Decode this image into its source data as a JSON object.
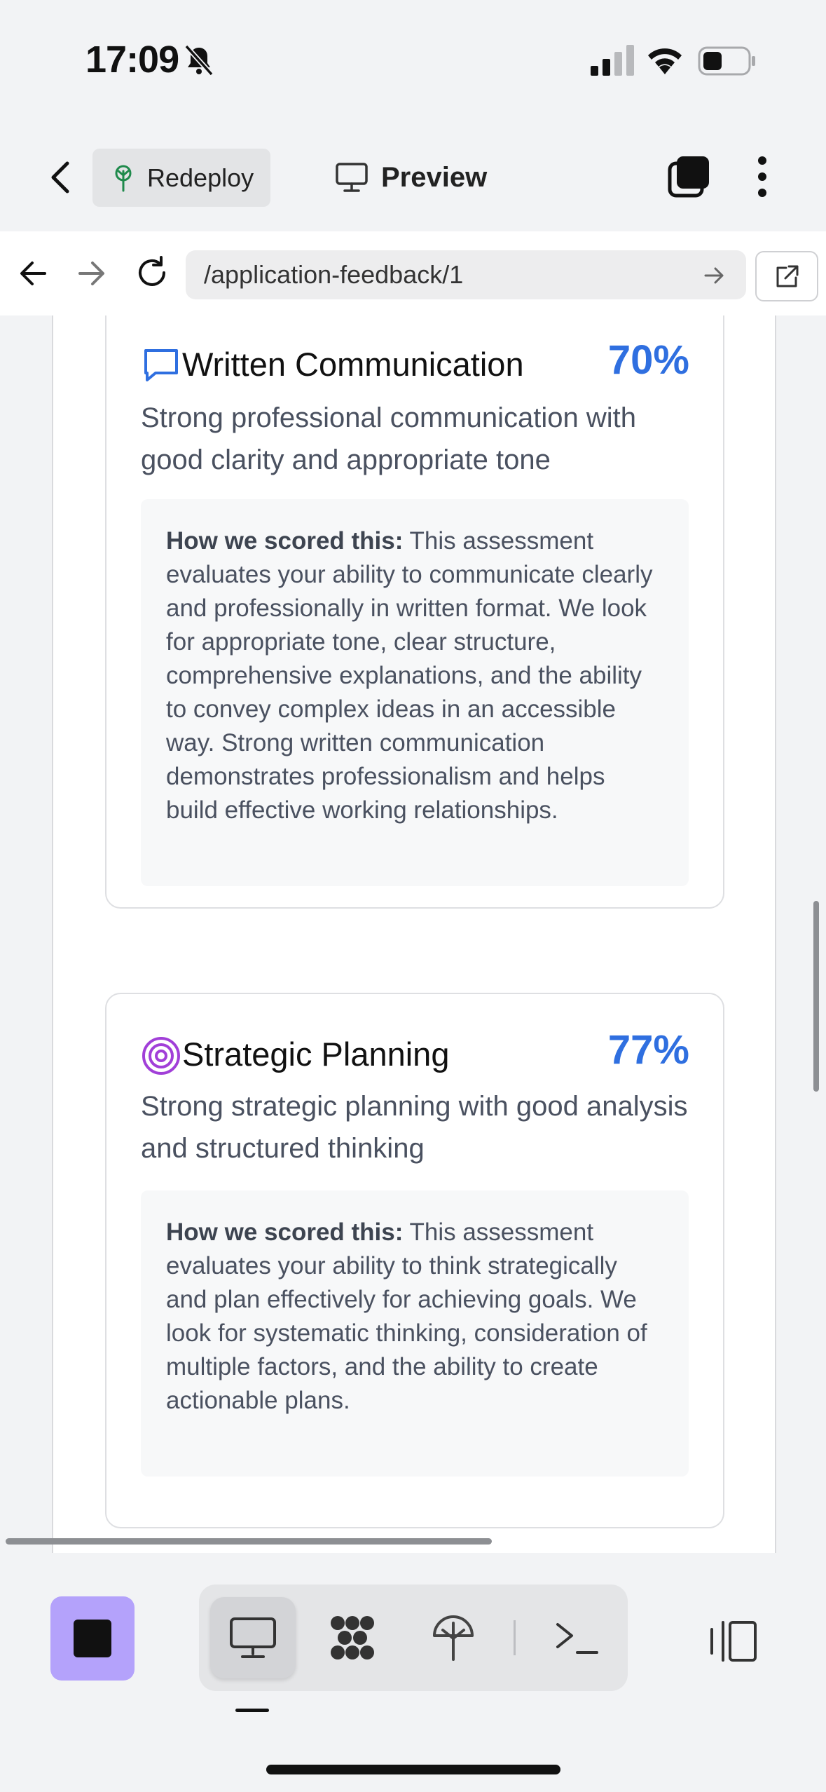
{
  "status": {
    "time": "17:09"
  },
  "topbar": {
    "redeploy_label": "Redeploy",
    "preview_label": "Preview"
  },
  "browser": {
    "url": "/application-feedback/1"
  },
  "cards": [
    {
      "title": "Written Communication",
      "percent": "70%",
      "icon": "chat-bubble-icon",
      "description": "Strong professional communication with good clarity and appropriate tone",
      "scored_label": "How we scored this:",
      "scored_text": " This assessment evaluates your ability to communicate clearly and professionally in written format. We look for appropriate tone, clear structure, comprehensive explanations, and the ability to convey complex ideas in an accessible way. Strong written communication demonstrates professionalism and helps build effective working relationships."
    },
    {
      "title": "Strategic Planning",
      "percent": "77%",
      "icon": "target-icon",
      "description": "Strong strategic planning with good analysis and structured thinking",
      "scored_label": "How we scored this:",
      "scored_text": " This assessment evaluates your ability to think strategically and plan effectively for achieving goals. We look for systematic thinking, consideration of multiple factors, and the ability to create actionable plans."
    }
  ],
  "colors": {
    "accent_blue": "#2f6fe0",
    "stop_purple": "#b4a2fb",
    "target_purple": "#a13fd8"
  }
}
